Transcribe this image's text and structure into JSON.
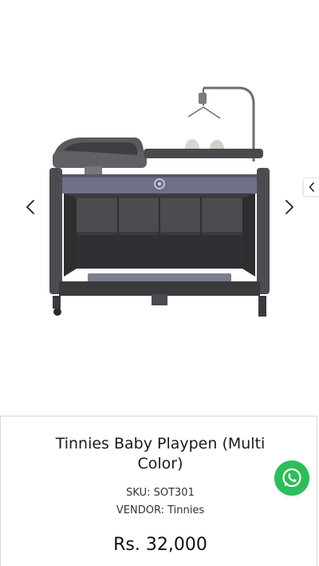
{
  "gallery": {
    "image_alt": "Tinnies Baby Playpen (Multi Color)",
    "prev_icon": "chevron-left-icon",
    "next_icon": "chevron-right-icon",
    "side_tab_icon": "chevron-left-icon"
  },
  "product": {
    "title": "Tinnies Baby Playpen (Multi Color)",
    "sku_label": "SKU:",
    "sku_value": "SOT301",
    "vendor_label": "VENDOR:",
    "vendor_value": "Tinnies",
    "price": "Rs. 32,000"
  },
  "whatsapp": {
    "icon": "whatsapp-icon",
    "color": "#2dbd5a"
  }
}
